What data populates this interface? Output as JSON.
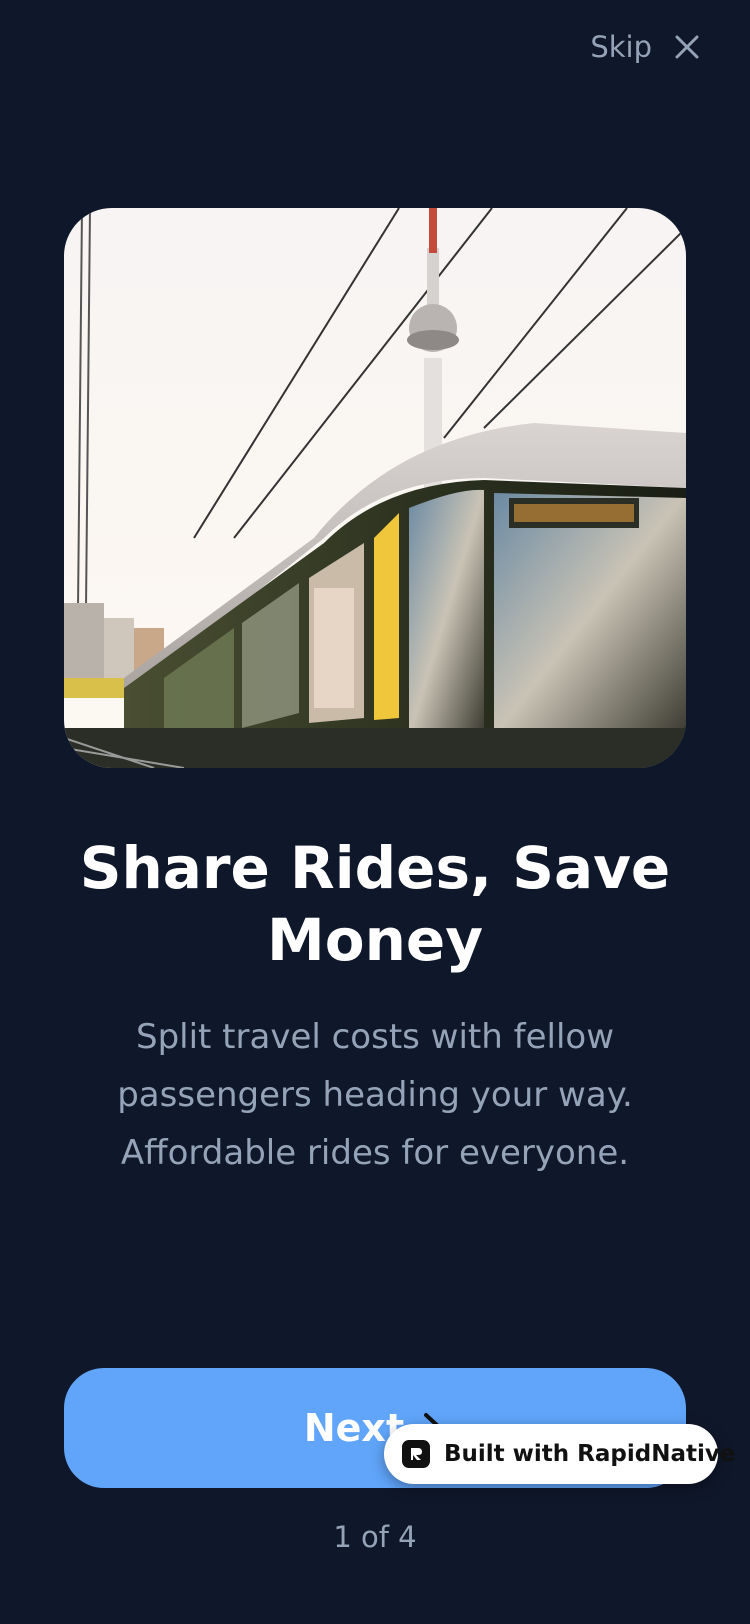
{
  "header": {
    "skip_label": "Skip",
    "close_icon": "close-icon"
  },
  "hero": {
    "image_description": "tram-tv-tower-photo"
  },
  "content": {
    "title": "Share Rides, Save Money",
    "subtitle": "Split travel costs with fellow passengers heading your way. Affordable rides for everyone."
  },
  "actions": {
    "next_label": "Next",
    "next_icon": "chevron-right-icon"
  },
  "badge": {
    "label": "Built with RapidNative",
    "icon": "rapidnative-logo-icon"
  },
  "pager": {
    "label": "1 of 4",
    "current": 1,
    "total": 4
  },
  "colors": {
    "background": "#0f172a",
    "primary": "#60a5fa",
    "muted_text": "#94a3b8",
    "title_text": "#ffffff"
  }
}
